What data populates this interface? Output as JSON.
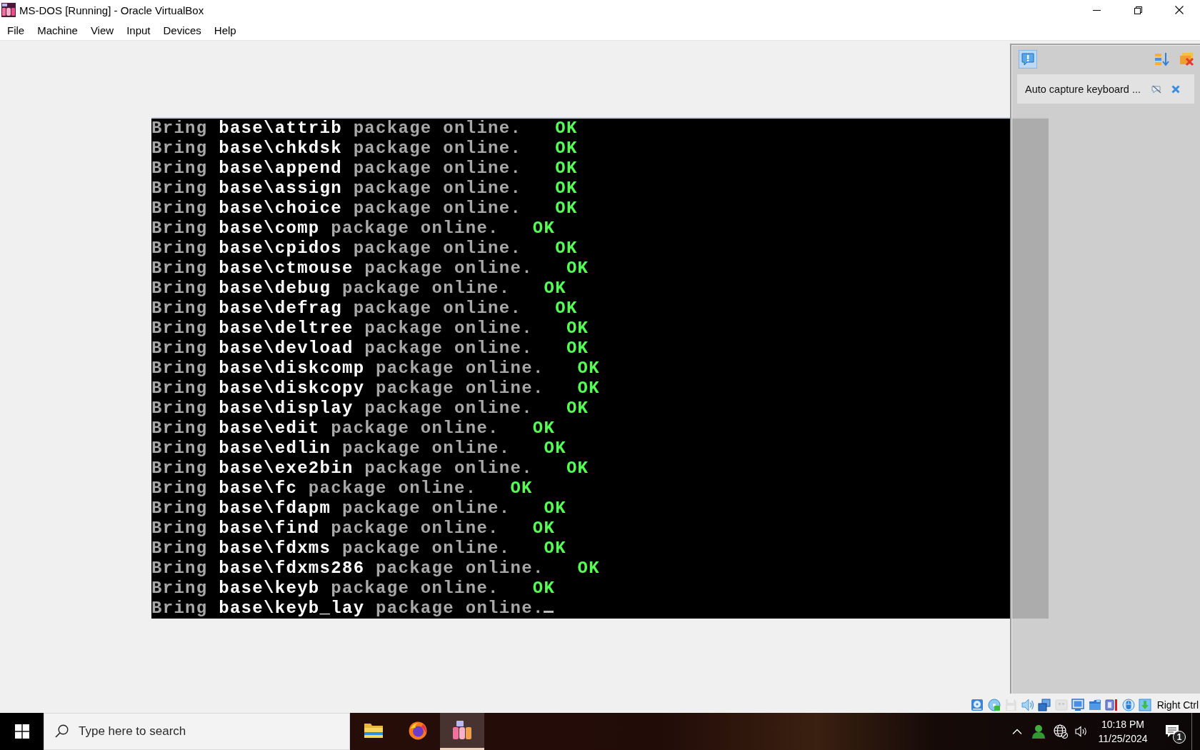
{
  "window": {
    "title": "MS-DOS [Running] - Oracle VirtualBox"
  },
  "menu": [
    "File",
    "Machine",
    "View",
    "Input",
    "Devices",
    "Help"
  ],
  "console": {
    "lines": [
      {
        "text": "Bring **base\\attrib** package online.",
        "status": "OK",
        "cursor": false
      },
      {
        "text": "Bring **base\\chkdsk** package online.",
        "status": "OK",
        "cursor": false
      },
      {
        "text": "Bring **base\\append** package online.",
        "status": "OK",
        "cursor": false
      },
      {
        "text": "Bring **base\\assign** package online.",
        "status": "OK",
        "cursor": false
      },
      {
        "text": "Bring **base\\choice** package online.",
        "status": "OK",
        "cursor": false
      },
      {
        "text": "Bring **base\\comp** package online.",
        "status": "OK",
        "cursor": false
      },
      {
        "text": "Bring **base\\cpidos** package online.",
        "status": "OK",
        "cursor": false
      },
      {
        "text": "Bring **base\\ctmouse** package online.",
        "status": "OK",
        "cursor": false
      },
      {
        "text": "Bring **base\\debug** package online.",
        "status": "OK",
        "cursor": false
      },
      {
        "text": "Bring **base\\defrag** package online.",
        "status": "OK",
        "cursor": false
      },
      {
        "text": "Bring **base\\deltree** package online.",
        "status": "OK",
        "cursor": false
      },
      {
        "text": "Bring **base\\devload** package online.",
        "status": "OK",
        "cursor": false
      },
      {
        "text": "Bring **base\\diskcomp** package online.",
        "status": "OK",
        "cursor": false
      },
      {
        "text": "Bring **base\\diskcopy** package online.",
        "status": "OK",
        "cursor": false
      },
      {
        "text": "Bring **base\\display** package online.",
        "status": "OK",
        "cursor": false
      },
      {
        "text": "Bring **base\\edit** package online.",
        "status": "OK",
        "cursor": false
      },
      {
        "text": "Bring **base\\edlin** package online.",
        "status": "OK",
        "cursor": false
      },
      {
        "text": "Bring **base\\exe2bin** package online.",
        "status": "OK",
        "cursor": false
      },
      {
        "text": "Bring **base\\fc** package online.",
        "status": "OK",
        "cursor": false
      },
      {
        "text": "Bring **base\\fdapm** package online.",
        "status": "OK",
        "cursor": false
      },
      {
        "text": "Bring **base\\find** package online.",
        "status": "OK",
        "cursor": false
      },
      {
        "text": "Bring **base\\fdxms** package online.",
        "status": "OK",
        "cursor": false
      },
      {
        "text": "Bring **base\\fdxms286** package online.",
        "status": "OK",
        "cursor": false
      },
      {
        "text": "Bring **base\\keyb** package online.",
        "status": "OK",
        "cursor": false
      },
      {
        "text": "Bring **base\\keyb_lay** package online.",
        "cursor": true
      }
    ]
  },
  "notification_center": {
    "toggle_on": true,
    "messages": [
      {
        "text": "Auto capture keyboard ..."
      }
    ]
  },
  "status_bar": {
    "devices": [
      {
        "kind": "hdd",
        "disabled": false
      },
      {
        "kind": "optical",
        "disabled": false
      },
      {
        "kind": "floppy",
        "disabled": true
      },
      {
        "kind": "audio",
        "disabled": false
      },
      {
        "kind": "network",
        "disabled": false
      },
      {
        "kind": "usb",
        "disabled": true
      },
      {
        "kind": "display",
        "disabled": false
      },
      {
        "kind": "shared",
        "disabled": false
      },
      {
        "kind": "cpu",
        "disabled": false
      },
      {
        "kind": "mouse",
        "disabled": false
      },
      {
        "kind": "keyboard",
        "disabled": false
      }
    ],
    "host_key": "Right Ctrl"
  },
  "taskbar": {
    "search": {
      "placeholder": "Type here to search"
    },
    "apps": [
      {
        "kind": "files",
        "selected": false
      },
      {
        "kind": "browser",
        "selected": false
      },
      {
        "kind": "dos",
        "selected": true
      }
    ],
    "tray": {
      "time": "10:18 PM",
      "date": "11/25/2024",
      "notification_count": "1"
    }
  }
}
